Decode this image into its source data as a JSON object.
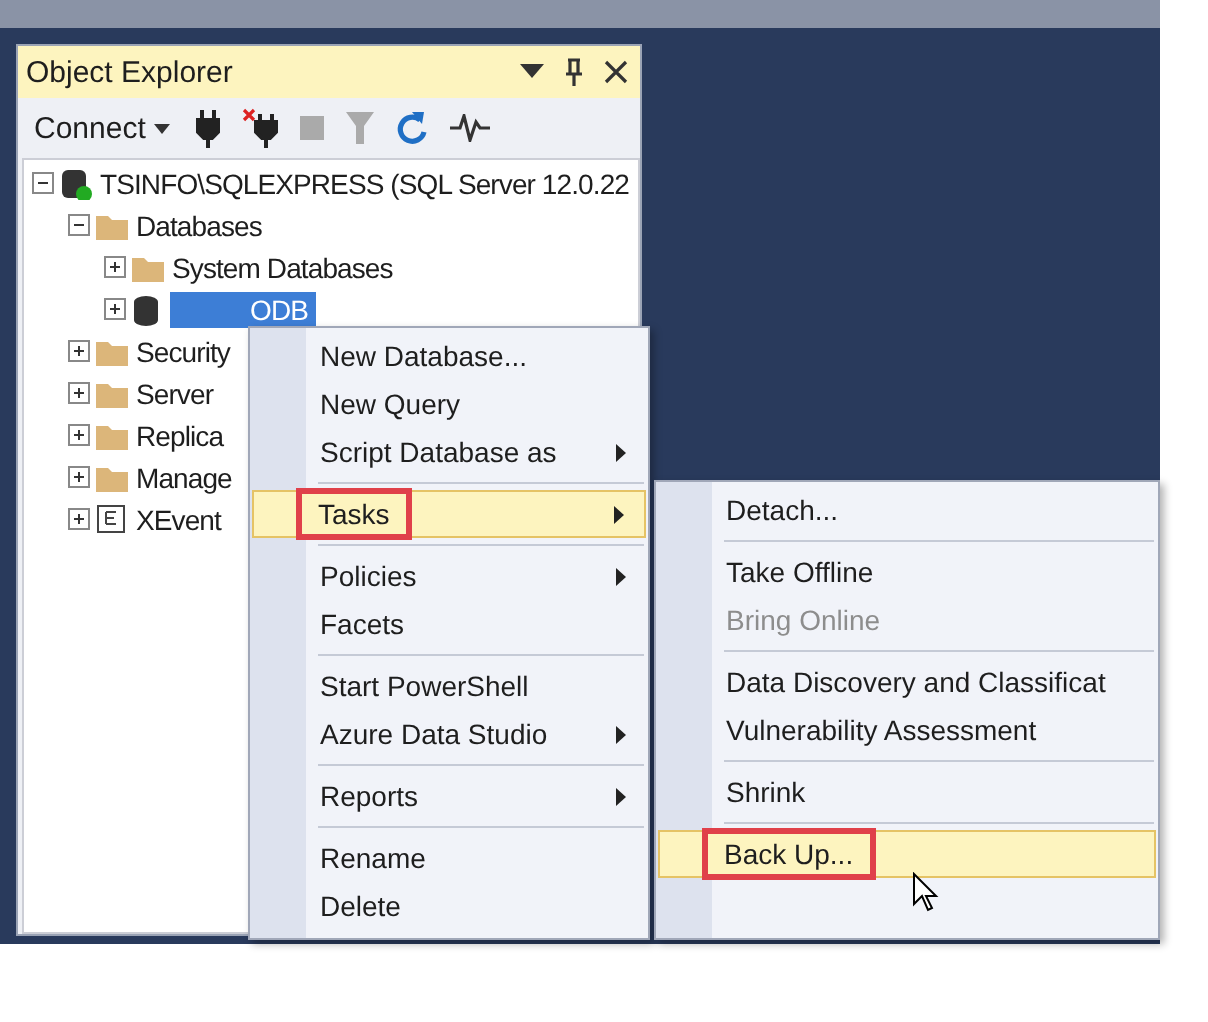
{
  "object_explorer": {
    "title": "Object Explorer",
    "toolbar": {
      "connect": "Connect"
    },
    "tree": [
      {
        "label": "TSINFO\\SQLEXPRESS (SQL Server 12.0.22",
        "kind": "server",
        "expanded": true,
        "selected": false,
        "children": [
          {
            "label": "Databases",
            "kind": "folder",
            "expanded": true,
            "selected": false,
            "children": [
              {
                "label": "System Databases",
                "kind": "folder",
                "expanded": false,
                "selected": false
              },
              {
                "label": "ODB",
                "kind": "database",
                "expanded": false,
                "selected": true
              }
            ]
          },
          {
            "label": "Security",
            "kind": "folder",
            "expanded": false,
            "selected": false
          },
          {
            "label": "Server",
            "kind": "folder",
            "expanded": false,
            "selected": false
          },
          {
            "label": "Replica",
            "kind": "folder",
            "expanded": false,
            "selected": false
          },
          {
            "label": "Manage",
            "kind": "folder",
            "expanded": false,
            "selected": false
          },
          {
            "label": "XEvent",
            "kind": "xevent",
            "expanded": false,
            "selected": false
          }
        ]
      }
    ]
  },
  "context_menu": {
    "items": [
      {
        "kind": "item",
        "label": "New Database...",
        "submenu": false,
        "selected": false,
        "outlined": false
      },
      {
        "kind": "item",
        "label": "New Query",
        "submenu": false,
        "selected": false,
        "outlined": false
      },
      {
        "kind": "item",
        "label": "Script Database as",
        "submenu": true,
        "selected": false,
        "outlined": false
      },
      {
        "kind": "separator"
      },
      {
        "kind": "item",
        "label": "Tasks",
        "submenu": true,
        "selected": true,
        "outlined": true
      },
      {
        "kind": "separator"
      },
      {
        "kind": "item",
        "label": "Policies",
        "submenu": true,
        "selected": false,
        "outlined": false
      },
      {
        "kind": "item",
        "label": "Facets",
        "submenu": false,
        "selected": false,
        "outlined": false
      },
      {
        "kind": "separator"
      },
      {
        "kind": "item",
        "label": "Start PowerShell",
        "submenu": false,
        "selected": false,
        "outlined": false
      },
      {
        "kind": "item",
        "label": "Azure Data Studio",
        "submenu": true,
        "selected": false,
        "outlined": false
      },
      {
        "kind": "separator"
      },
      {
        "kind": "item",
        "label": "Reports",
        "submenu": true,
        "selected": false,
        "outlined": false
      },
      {
        "kind": "separator"
      },
      {
        "kind": "item",
        "label": "Rename",
        "submenu": false,
        "selected": false,
        "outlined": false
      },
      {
        "kind": "item",
        "label": "Delete",
        "submenu": false,
        "selected": false,
        "outlined": false
      }
    ]
  },
  "tasks_submenu": {
    "items": [
      {
        "kind": "item",
        "label": "Detach...",
        "disabled": false,
        "selected": false,
        "outlined": false
      },
      {
        "kind": "separator"
      },
      {
        "kind": "item",
        "label": "Take Offline",
        "disabled": false,
        "selected": false,
        "outlined": false
      },
      {
        "kind": "item",
        "label": "Bring Online",
        "disabled": true,
        "selected": false,
        "outlined": false
      },
      {
        "kind": "separator"
      },
      {
        "kind": "item",
        "label": "Data Discovery and Classificat",
        "disabled": false,
        "selected": false,
        "outlined": false
      },
      {
        "kind": "item",
        "label": "Vulnerability Assessment",
        "disabled": false,
        "selected": false,
        "outlined": false
      },
      {
        "kind": "separator"
      },
      {
        "kind": "item",
        "label": "Shrink",
        "disabled": false,
        "selected": false,
        "outlined": false
      },
      {
        "kind": "separator"
      },
      {
        "kind": "item",
        "label": "Back Up...",
        "disabled": false,
        "selected": true,
        "outlined": true
      }
    ]
  }
}
